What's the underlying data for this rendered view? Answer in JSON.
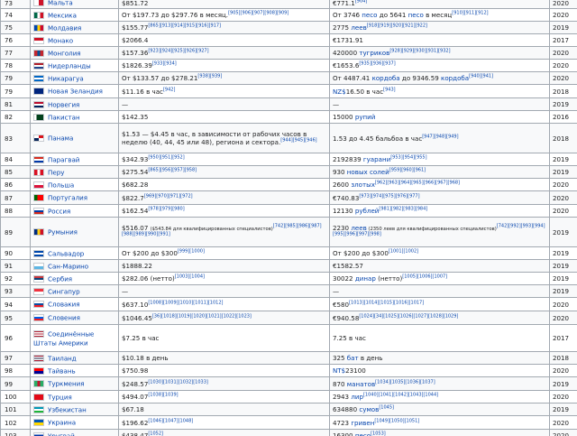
{
  "table": {
    "rows": [
      {
        "num": "73",
        "country": "Мальта",
        "flag": [
          "#ffffff",
          "#cf142b"
        ],
        "flag_dir": "v",
        "dollar": "$851.72",
        "dollar_refs": "",
        "local": "€771.1",
        "local_refs": "[904]",
        "year": "2020"
      },
      {
        "num": "74",
        "country": "Мексика",
        "flag": [
          "#006847",
          "#ffffff",
          "#ce1126"
        ],
        "flag_dir": "v",
        "dollar": "От $197.73 до $297.76 в месяц.",
        "dollar_refs": "[905][906][907][908][909]",
        "local": "От 3746 ",
        "local_link": "песо",
        "local_after": " до 5641 ",
        "local_link2": "песо",
        "local_after2": " в месяц",
        "local_refs": "[910][911][912]",
        "year": "2020"
      },
      {
        "num": "75",
        "country": "Молдавия",
        "flag": [
          "#0046ae",
          "#ffd200",
          "#cc092f"
        ],
        "flag_dir": "v",
        "dollar": "$155.77",
        "dollar_refs": "[865][913][914][915][916][917]",
        "local": "2775 ",
        "local_link": "леев",
        "local_refs": "[918][919][920][921][922]",
        "year": "2019"
      },
      {
        "num": "76",
        "country": "Монако",
        "flag": [
          "#ce1126",
          "#ffffff"
        ],
        "flag_dir": "h",
        "dollar": "$2066.4",
        "dollar_refs": "",
        "local": "€1731.91",
        "local_refs": "",
        "year": "2017"
      },
      {
        "num": "77",
        "country": "Монголия",
        "flag": [
          "#c4272f",
          "#015197",
          "#c4272f"
        ],
        "flag_dir": "v",
        "dollar": "$157.36",
        "dollar_refs": "[923][924][925][926][927]",
        "local": "420000 ",
        "local_link": "тугриков",
        "local_refs": "[928][929][930][931][932]",
        "year": "2020"
      },
      {
        "num": "78",
        "country": "Нидерланды",
        "flag": [
          "#ae1c28",
          "#ffffff",
          "#21468b"
        ],
        "flag_dir": "h",
        "dollar": "$1826.39",
        "dollar_refs": "[933][934]",
        "local": "€1653.6",
        "local_refs": "[935][936][937]",
        "year": "2020"
      },
      {
        "num": "79",
        "country": "Никарагуа",
        "flag": [
          "#0067c6",
          "#ffffff",
          "#0067c6"
        ],
        "flag_dir": "h",
        "dollar": "От $133.57 до $278.21",
        "dollar_refs": "[938][939]",
        "local": "От 4487.41 ",
        "local_link": "кордоба",
        "local_after": " до 9346.59 ",
        "local_link2": "кордоба",
        "local_refs": "[940][941]",
        "year": "2020"
      },
      {
        "num": "79",
        "country": "Новая Зеландия",
        "flag": [
          "#00247d",
          "#00247d"
        ],
        "flag_dir": "h",
        "dollar": "$11.16 в час",
        "dollar_refs": "[942]",
        "local": "",
        "local_link": "NZ$",
        "local_after": "16.50 в час",
        "local_refs": "[943]",
        "year": "2018"
      },
      {
        "num": "81",
        "country": "Норвегия",
        "flag": [
          "#ba0c2f",
          "#ffffff",
          "#00205b"
        ],
        "flag_dir": "h",
        "dollar": "—",
        "dollar_refs": "",
        "local": "—",
        "local_refs": "",
        "year": "2019"
      },
      {
        "num": "82",
        "country": "Пакистан",
        "flag": [
          "#ffffff",
          "#01411c",
          "#01411c",
          "#01411c"
        ],
        "flag_dir": "v",
        "dollar": "$142.35",
        "dollar_refs": "",
        "local": "15000 ",
        "local_link": "рупий",
        "local_refs": "",
        "year": "2016"
      },
      {
        "num": "83",
        "country": "Панама",
        "flag": [
          "#ffffff",
          "#da121a",
          "#072357",
          "#ffffff"
        ],
        "flag_dir": "grid",
        "dollar": "$1.53 — $4.45 в час, в зависимости от рабочих часов в неделю (40, 44, 45 или 48), региона и сектора.",
        "dollar_refs": "[944][945][946]",
        "dollar_wrap": true,
        "local": "1.53 до 4.45 бальбоа в час",
        "local_refs": "[947][948][949]",
        "year": "2018"
      },
      {
        "num": "84",
        "country": "Парагвай",
        "flag": [
          "#d52b1e",
          "#ffffff",
          "#0038a8"
        ],
        "flag_dir": "h",
        "dollar": "$342.93",
        "dollar_refs": "[950][951][952]",
        "local": "2192839 ",
        "local_link": "гуарани",
        "local_refs": "[953][954][955]",
        "year": "2019"
      },
      {
        "num": "85",
        "country": "Перу",
        "flag": [
          "#d91023",
          "#ffffff",
          "#d91023"
        ],
        "flag_dir": "v",
        "dollar": "$275.54",
        "dollar_refs": "[865][956][957][958]",
        "local": "930 ",
        "local_link": "новых солей",
        "local_refs": "[959][960][961]",
        "year": "2019"
      },
      {
        "num": "86",
        "country": "Польша",
        "flag": [
          "#ffffff",
          "#dc143c"
        ],
        "flag_dir": "h",
        "dollar": "$682.28",
        "dollar_refs": "",
        "local": "2600 ",
        "local_link": "злотых",
        "local_refs": "[962][963][964][965][966][967][968]",
        "year": "2020"
      },
      {
        "num": "87",
        "country": "Португалия",
        "flag": [
          "#006600",
          "#ff0000",
          "#ff0000"
        ],
        "flag_dir": "v",
        "dollar": "$822.7",
        "dollar_refs": "[969][970][971][972]",
        "local": "€740.83",
        "local_refs": "[973][974][975][976][977]",
        "year": "2020"
      },
      {
        "num": "88",
        "country": "Россия",
        "flag": [
          "#ffffff",
          "#0039a6",
          "#d52b1e"
        ],
        "flag_dir": "h",
        "dollar": "$162.54",
        "dollar_refs": "[978][979][980]",
        "local": "12130 ",
        "local_link": "рублей",
        "local_refs": "[981][982][983][984]",
        "year": "2020",
        "mark": [
          40,
          228
        ]
      },
      {
        "num": "89",
        "country": "Румыния",
        "flag": [
          "#002b7f",
          "#fcd116",
          "#ce1126"
        ],
        "flag_dir": "v",
        "dollar": "$516.07 ",
        "dollar_small": "($543.84 для квалифицированных специалистов)",
        "dollar_refs": "[742][985][986][987][988][989][990][991]",
        "dollar_wrap": true,
        "local": "2230 ",
        "local_link": "леев",
        "local_small": " (2350 леев для квалифицированных специалистов)",
        "local_refs": "[742][992][993][994][995][996][997][998]",
        "local_wrap": true,
        "year": "2019"
      },
      {
        "num": "90",
        "country": "Сальвадор",
        "flag": [
          "#0047ab",
          "#ffffff",
          "#0047ab"
        ],
        "flag_dir": "h",
        "dollar": "От $200 до $300",
        "dollar_refs": "[999][1000]",
        "local": "От $200 до $300",
        "local_refs": "[1001][1002]",
        "year": "2019"
      },
      {
        "num": "91",
        "country": "Сан-Марино",
        "flag": [
          "#ffffff",
          "#5eb6e4"
        ],
        "flag_dir": "h",
        "dollar": "$1888.22",
        "dollar_refs": "",
        "local": "€1582.57",
        "local_refs": "",
        "year": "2019"
      },
      {
        "num": "92",
        "country": "Сербия",
        "flag": [
          "#c6363c",
          "#0c4076",
          "#ffffff"
        ],
        "flag_dir": "h",
        "dollar": "$282.06 (нетто)",
        "dollar_refs": "[1003][1004]",
        "local": "30022 ",
        "local_link": "динар",
        "local_after": " (нетто)",
        "local_refs": "[1005][1006][1007]",
        "year": "2019"
      },
      {
        "num": "93",
        "country": "Сингапур",
        "flag": [
          "#ef3340",
          "#ffffff"
        ],
        "flag_dir": "h",
        "dollar": "—",
        "dollar_refs": "",
        "local": "—",
        "local_refs": "",
        "year": "2019"
      },
      {
        "num": "94",
        "country": "Словакия",
        "flag": [
          "#ffffff",
          "#0b4ea2",
          "#ee1c25"
        ],
        "flag_dir": "h",
        "dollar": "$637.10",
        "dollar_refs": "[1008][1009][1010][1011][1012]",
        "local": "€580",
        "local_refs": "[1013][1014][1015][1016][1017]",
        "year": "2020",
        "mark": [
          40,
          130
        ]
      },
      {
        "num": "95",
        "country": "Словения",
        "flag": [
          "#ffffff",
          "#005ce5",
          "#ed1c24"
        ],
        "flag_dir": "h",
        "dollar": "$1046.45",
        "dollar_refs": "[36][1018][1019][1020][1021][1022][1023]",
        "local": "€940.58",
        "local_refs": "[1024][34][1025][1026][1027][1028][1029]",
        "year": "2020",
        "mark": [
          40,
          146
        ]
      },
      {
        "num": "96",
        "country": "Соединённые Штаты Америки",
        "flag": [
          "#b22234",
          "#ffffff",
          "#b22234",
          "#ffffff",
          "#b22234"
        ],
        "flag_dir": "h",
        "dollar": "$7.25 в час",
        "dollar_refs": "",
        "local": "7.25 в час",
        "local_refs": "",
        "year": "2017",
        "country_wrap": true
      },
      {
        "num": "97",
        "country": "Таиланд",
        "flag": [
          "#a51931",
          "#f4f5f8",
          "#2d2a4a",
          "#f4f5f8",
          "#a51931"
        ],
        "flag_dir": "h",
        "dollar": "$10.18 в день",
        "dollar_refs": "",
        "local": "325 ",
        "local_link": "бат",
        "local_after": " в день",
        "local_refs": "",
        "year": "2018"
      },
      {
        "num": "98",
        "country": "Тайвань",
        "flag": [
          "#fe0000",
          "#000095"
        ],
        "flag_dir": "h",
        "dollar": "$750.98",
        "dollar_refs": "",
        "local": "",
        "local_link": "NT$",
        "local_after": "23100",
        "local_refs": "",
        "year": "2020",
        "mark": [
          40,
          98
        ]
      },
      {
        "num": "99",
        "country": "Туркмения",
        "flag": [
          "#28ae66",
          "#c8102e",
          "#28ae66"
        ],
        "flag_dir": "v",
        "dollar": "$248.57",
        "dollar_refs": "[1030][1031][1032][1033]",
        "local": "870 ",
        "local_link": "манатов",
        "local_refs": "[1034][1035][1036][1037]",
        "year": "2019",
        "mark": [
          40,
          118
        ]
      },
      {
        "num": "100",
        "country": "Турция",
        "flag": [
          "#e30a17",
          "#e30a17"
        ],
        "flag_dir": "h",
        "dollar": "$494.07",
        "dollar_refs": "[1038][1039]",
        "local": "2943 ",
        "local_link": "лир",
        "local_refs": "[1040][1041][1042][1043][1044]",
        "year": "2020",
        "mark": [
          40,
          166
        ]
      },
      {
        "num": "101",
        "country": "Узбекистан",
        "flag": [
          "#0099b5",
          "#ffffff",
          "#1eb53a"
        ],
        "flag_dir": "h",
        "dollar": "$67.18",
        "dollar_refs": "",
        "local": "634880 ",
        "local_link": "сумов",
        "local_refs": "[1045]",
        "year": "2019",
        "mark": [
          40,
          118
        ]
      },
      {
        "num": "102",
        "country": "Украина",
        "flag": [
          "#0057b7",
          "#ffd700"
        ],
        "flag_dir": "h",
        "dollar": "$196.62",
        "dollar_refs": "[1046][1047][1048]",
        "local": "4723 ",
        "local_link": "гривен",
        "local_refs": "[1049][1050][1051]",
        "year": "2020",
        "mark": [
          40,
          222
        ]
      },
      {
        "num": "103",
        "country": "Уругвай",
        "flag": [
          "#ffffff",
          "#0038a8",
          "#ffffff",
          "#0038a8"
        ],
        "flag_dir": "h",
        "dollar": "$438.47",
        "dollar_refs": "[1052]",
        "local": "16300 ",
        "local_link": "песо",
        "local_refs": "[1053]",
        "year": "2020"
      }
    ]
  },
  "colors": {
    "link": "#0645ad",
    "border": "#a2a9b1",
    "row_alt": "#f8f9fa",
    "underline_mark": "#e0142c"
  }
}
